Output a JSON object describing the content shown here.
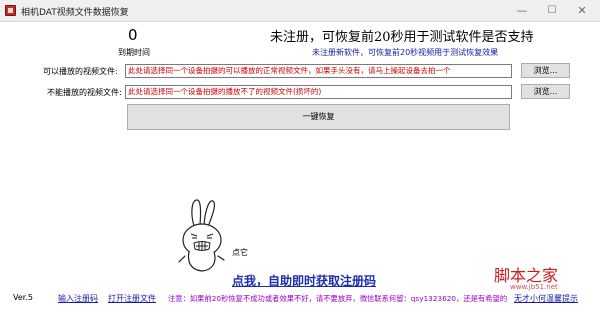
{
  "window": {
    "title": "相机DAT视频文件数据恢复",
    "controls": {
      "minimize": "—",
      "maximize": "☐",
      "close": "✕"
    }
  },
  "header": {
    "counter": "0",
    "headline": "未注册，可恢复前20秒用于测试软件是否支持",
    "countdown_label": "到期时间",
    "notice": "未注册新软件，可恢复前20秒视频用于测试恢复效果"
  },
  "form": {
    "playable": {
      "label": "可以播放的视频文件:",
      "value": "此处请选择同一个设备拍摄的可以播放的正常视频文件，如果手头没有，请马上操起设备去拍一个",
      "browse_label": "浏览..."
    },
    "unplayable": {
      "label": "不能播放的视频文件:",
      "value": "此处请选择同一个设备拍摄的播放不了的视频文件(损坏的)",
      "browse_label": "浏览..."
    },
    "recover_label": "一键恢复"
  },
  "mascot": {
    "caption": "点它",
    "icon": "bunny-mascot-icon"
  },
  "cta": {
    "label": "点我，自助即时获取注册码"
  },
  "status_bar": {
    "version": "Ver.5",
    "enter_code": "输入注册码",
    "open_reg_file": "打开注册文件",
    "warning": "注意：如果前20秒恢复不成功或者效果不好，请不要放弃，微信联系何留：qsy1323620，还是有希望的",
    "help": "无才小何温馨提示"
  },
  "watermark": {
    "text": "脚本之家",
    "url": "www.jb51.net"
  }
}
